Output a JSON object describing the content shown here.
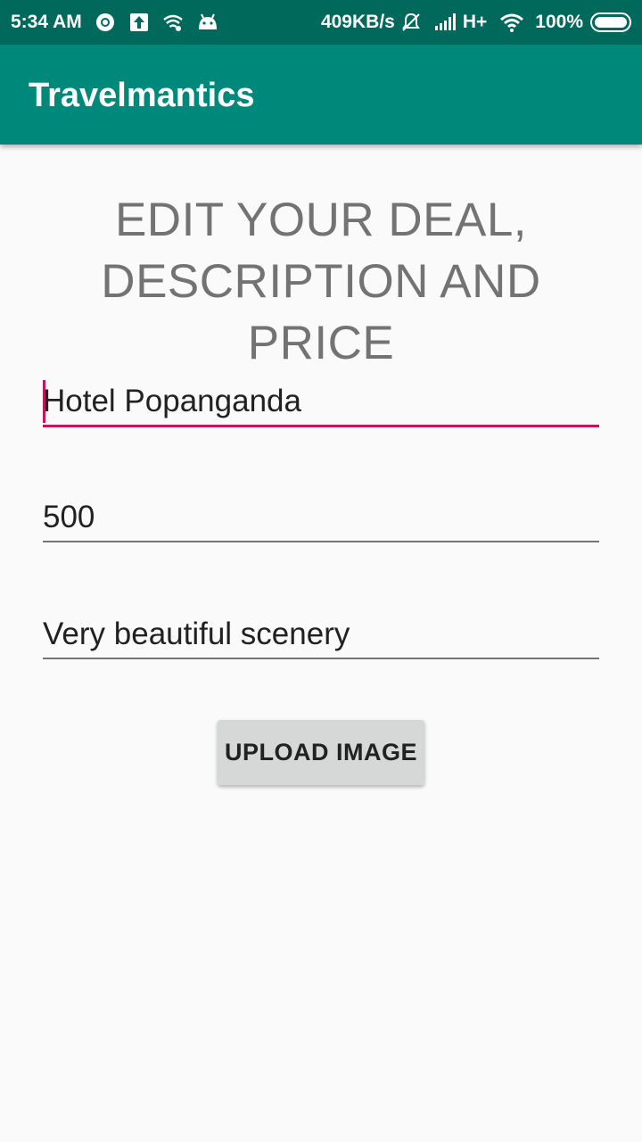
{
  "status_bar": {
    "time": "5:34 AM",
    "network_speed": "409KB/s",
    "network_type": "H+",
    "battery": "100%",
    "icons_left": [
      "chrome-icon",
      "upload-notification-icon",
      "wifi-notification-icon",
      "android-debug-icon"
    ],
    "icons_right": [
      "mute-icon",
      "signal-icon",
      "wifi-icon",
      "battery-icon"
    ]
  },
  "app_bar": {
    "title": "Travelmantics",
    "color": "#00897b",
    "status_color": "#00695c"
  },
  "form": {
    "heading": "EDIT YOUR DEAL, DESCRIPTION AND PRICE",
    "title_value": "Hotel Popanganda",
    "price_value": "500",
    "description_value": "Very beautiful scenery",
    "upload_button_label": "UPLOAD IMAGE",
    "accent_color": "#c2185b"
  }
}
